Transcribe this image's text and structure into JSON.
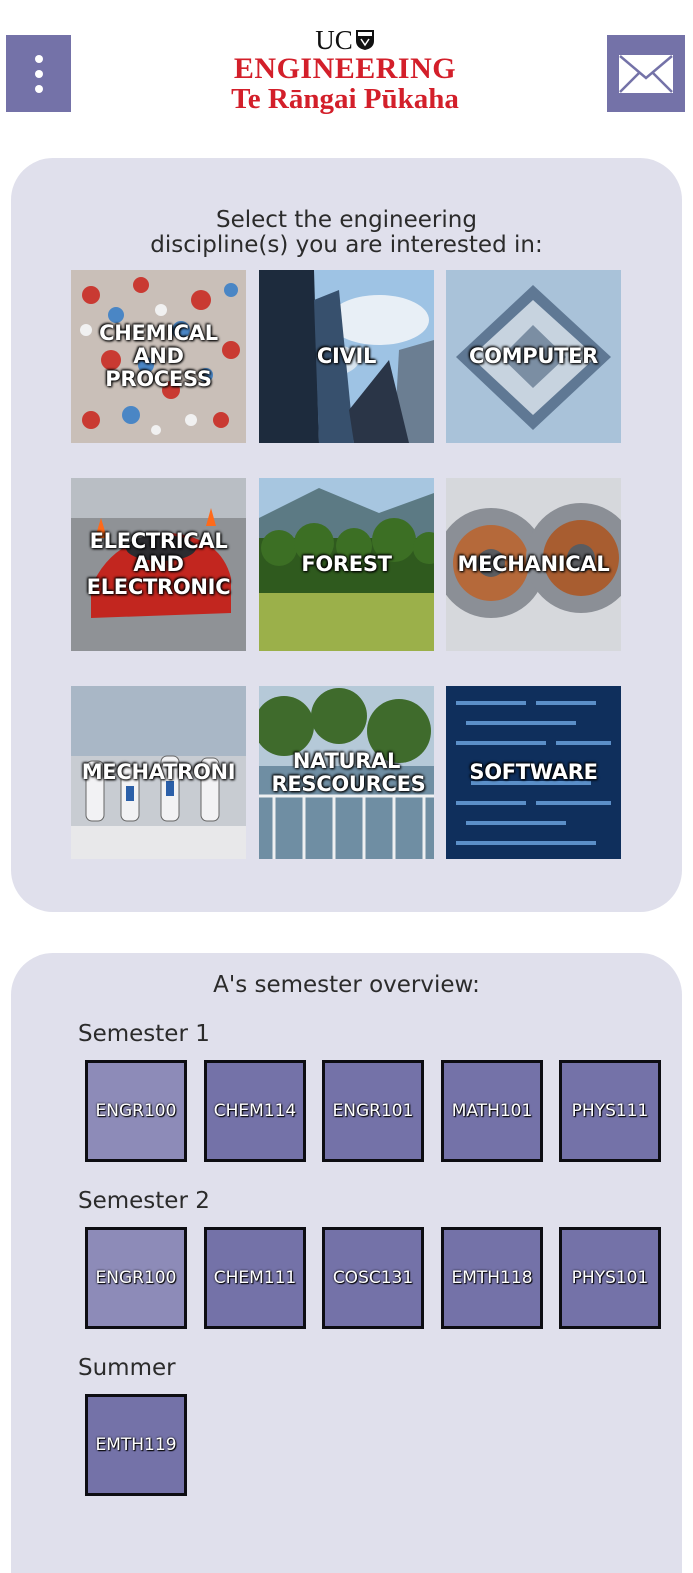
{
  "header": {
    "menu_icon": "vertical-dots-icon",
    "mail_icon": "envelope-icon",
    "logo": {
      "uc": "UC",
      "title": "ENGINEERING",
      "subtitle": "Te Rāngai Pūkaha"
    }
  },
  "disciplines": {
    "heading_line1": "Select the engineering",
    "heading_line2": "discipline(s) you are interested in:",
    "items": [
      {
        "label": "CHEMICAL AND PROCESS"
      },
      {
        "label": "CIVIL"
      },
      {
        "label": "COMPUTER"
      },
      {
        "label": "ELECTRICAL AND ELECTRONIC"
      },
      {
        "label": "FOREST"
      },
      {
        "label": "MECHANICAL"
      },
      {
        "label": "MECHATRONI"
      },
      {
        "label": "NATURAL RESCOURCES"
      },
      {
        "label": "SOFTWARE"
      }
    ]
  },
  "overview": {
    "heading": "A's semester overview:",
    "semesters": [
      {
        "label": "Semester 1",
        "courses": [
          "ENGR100",
          "CHEM114",
          "ENGR101",
          "MATH101",
          "PHYS111"
        ]
      },
      {
        "label": "Semester 2",
        "courses": [
          "ENGR100",
          "CHEM111",
          "COSC131",
          "EMTH118",
          "PHYS101"
        ]
      },
      {
        "label": "Summer",
        "courses": [
          "EMTH119"
        ]
      }
    ]
  },
  "colors": {
    "accent": "#7472a8",
    "brand_red": "#d31f2a",
    "card_bg": "#e0e0ec"
  }
}
